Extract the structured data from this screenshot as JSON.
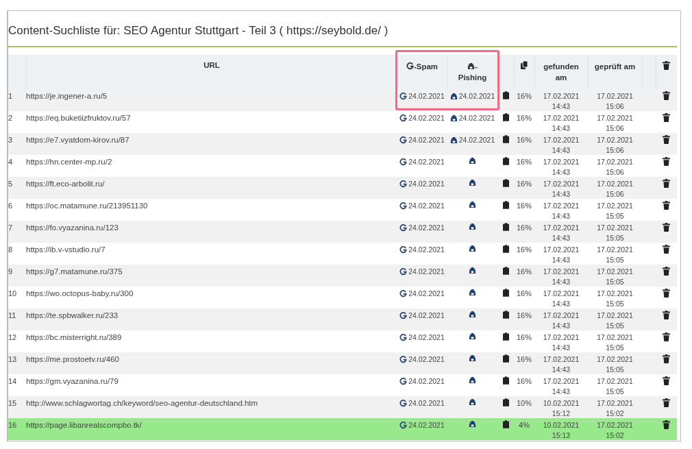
{
  "title": "Content-Suchliste für: SEO Agentur Stuttgart - Teil 3 ( https://seybold.de/ )",
  "columns": {
    "url": "URL",
    "spam": "-Spam",
    "phishing": "-Pishing",
    "found": "gefunden am",
    "checked": "geprüft am"
  },
  "rows": [
    {
      "num": "1",
      "url": "https://je.ingener-a.ru/5",
      "spam_date": "24.02.2021",
      "phishing_date": "24.02.2021",
      "percent": "16%",
      "found_date": "17.02.2021",
      "found_time": "14:43",
      "checked_date": "17.02.2021",
      "checked_time": "15:06",
      "highlighted": false
    },
    {
      "num": "2",
      "url": "https://eq.buketiizfruktov.ru/57",
      "spam_date": "24.02.2021",
      "phishing_date": "24.02.2021",
      "percent": "16%",
      "found_date": "17.02.2021",
      "found_time": "14:43",
      "checked_date": "17.02.2021",
      "checked_time": "15:06",
      "highlighted": false
    },
    {
      "num": "3",
      "url": "https://e7.vyatdom-kirov.ru/87",
      "spam_date": "24.02.2021",
      "phishing_date": "24.02.2021",
      "percent": "16%",
      "found_date": "17.02.2021",
      "found_time": "14:43",
      "checked_date": "17.02.2021",
      "checked_time": "15:06",
      "highlighted": false
    },
    {
      "num": "4",
      "url": "https://hn.center-mp.ru/2",
      "spam_date": "24.02.2021",
      "percent": "16%",
      "found_date": "17.02.2021",
      "found_time": "14:43",
      "checked_date": "17.02.2021",
      "checked_time": "15:06",
      "highlighted": false
    },
    {
      "num": "5",
      "url": "https://ft.eco-arbolit.ru/",
      "spam_date": "24.02.2021",
      "percent": "16%",
      "found_date": "17.02.2021",
      "found_time": "14:43",
      "checked_date": "17.02.2021",
      "checked_time": "15:06",
      "highlighted": false
    },
    {
      "num": "6",
      "url": "https://oc.matamune.ru/213951130",
      "spam_date": "24.02.2021",
      "percent": "16%",
      "found_date": "17.02.2021",
      "found_time": "14:43",
      "checked_date": "17.02.2021",
      "checked_time": "15:05",
      "highlighted": false
    },
    {
      "num": "7",
      "url": "https://fo.vyazanina.ru/123",
      "spam_date": "24.02.2021",
      "percent": "16%",
      "found_date": "17.02.2021",
      "found_time": "14:43",
      "checked_date": "17.02.2021",
      "checked_time": "15:05",
      "highlighted": false
    },
    {
      "num": "8",
      "url": "https://ib.v-vstudio.ru/7",
      "spam_date": "24.02.2021",
      "percent": "16%",
      "found_date": "17.02.2021",
      "found_time": "14:43",
      "checked_date": "17.02.2021",
      "checked_time": "15:05",
      "highlighted": false
    },
    {
      "num": "9",
      "url": "https://g7.matamune.ru/375",
      "spam_date": "24.02.2021",
      "percent": "16%",
      "found_date": "17.02.2021",
      "found_time": "14:43",
      "checked_date": "17.02.2021",
      "checked_time": "15:05",
      "highlighted": false
    },
    {
      "num": "10",
      "url": "https://wo.octopus-baby.ru/300",
      "spam_date": "24.02.2021",
      "percent": "16%",
      "found_date": "17.02.2021",
      "found_time": "14:43",
      "checked_date": "17.02.2021",
      "checked_time": "15:05",
      "highlighted": false
    },
    {
      "num": "11",
      "url": "https://te.spbwalker.ru/233",
      "spam_date": "24.02.2021",
      "percent": "16%",
      "found_date": "17.02.2021",
      "found_time": "14:43",
      "checked_date": "17.02.2021",
      "checked_time": "15:05",
      "highlighted": false
    },
    {
      "num": "12",
      "url": "https://bc.misterright.ru/389",
      "spam_date": "24.02.2021",
      "percent": "16%",
      "found_date": "17.02.2021",
      "found_time": "14:43",
      "checked_date": "17.02.2021",
      "checked_time": "15:05",
      "highlighted": false
    },
    {
      "num": "13",
      "url": "https://me.prostoetv.ru/460",
      "spam_date": "24.02.2021",
      "percent": "16%",
      "found_date": "17.02.2021",
      "found_time": "14:43",
      "checked_date": "17.02.2021",
      "checked_time": "15:05",
      "highlighted": false
    },
    {
      "num": "14",
      "url": "https://gm.vyazanina.ru/79",
      "spam_date": "24.02.2021",
      "percent": "16%",
      "found_date": "17.02.2021",
      "found_time": "14:43",
      "checked_date": "17.02.2021",
      "checked_time": "15:05",
      "highlighted": false
    },
    {
      "num": "15",
      "url": "http://www.schlagwortag.ch/keyword/seo-agentur-deutschland.htm",
      "spam_date": "24.02.2021",
      "percent": "10%",
      "found_date": "10.02.2021",
      "found_time": "15:12",
      "checked_date": "17.02.2021",
      "checked_time": "15:02",
      "highlighted": false
    },
    {
      "num": "16",
      "url": "https://page.libanrealscompbo.tk/",
      "spam_date": "24.02.2021",
      "percent": "4%",
      "found_date": "10.02.2021",
      "found_time": "15:13",
      "checked_date": "17.02.2021",
      "checked_time": "15:02",
      "highlighted": true
    }
  ]
}
